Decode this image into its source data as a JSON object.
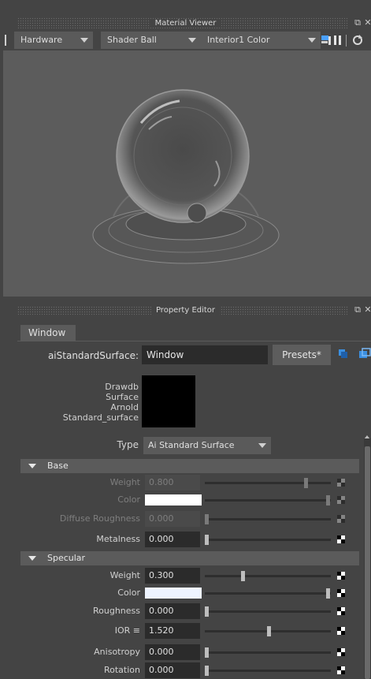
{
  "material_viewer": {
    "title": "Material Viewer",
    "renderer": "Hardware",
    "geometry": "Shader Ball",
    "environment": "Interior1 Color"
  },
  "property_editor": {
    "title": "Property Editor",
    "tab": "Window",
    "node_type_label": "aiStandardSurface:",
    "node_name": "Window",
    "presets_label": "Presets*",
    "swatch_label": "Drawdb\nSurface\nArnold\nStandard_surface",
    "type_label": "Type",
    "type_value": "Ai Standard Surface"
  },
  "sections": {
    "base": {
      "title": "Base",
      "weight_label": "Weight",
      "weight_value": "0.800",
      "weight_fraction": 0.8,
      "color_label": "Color",
      "color_hex": "#ffffff",
      "diffuse_roughness_label": "Diffuse Roughness",
      "diffuse_roughness_value": "0.000",
      "metalness_label": "Metalness",
      "metalness_value": "0.000"
    },
    "specular": {
      "title": "Specular",
      "weight_label": "Weight",
      "weight_value": "0.300",
      "weight_fraction": 0.3,
      "color_label": "Color",
      "color_hex": "#eef4ff",
      "roughness_label": "Roughness",
      "roughness_value": "0.000",
      "ior_label": "IOR ≡",
      "ior_value": "1.520",
      "anisotropy_label": "Anisotropy",
      "anisotropy_value": "0.000",
      "rotation_label": "Rotation",
      "rotation_value": "0.000"
    }
  },
  "colors": {
    "panel": "#444444",
    "field": "#2b2b2b",
    "viewport": "#5c5c5c"
  }
}
